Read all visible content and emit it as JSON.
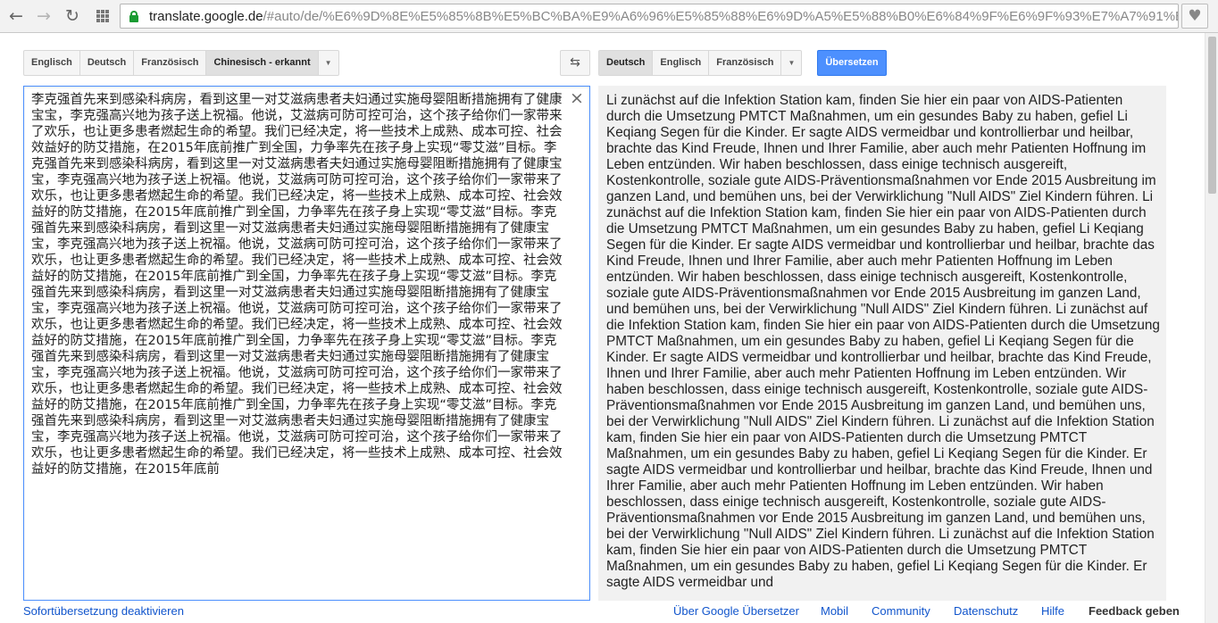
{
  "browser": {
    "back_icon": "arrow-left-icon",
    "forward_icon": "arrow-right-icon",
    "reload_icon": "reload-icon",
    "url_host": "translate.google.de",
    "url_path": "/#auto/de/%E6%9D%8E%E5%85%8B%E5%BC%BA%E9%A6%96%E5%85%88%E6%9D%A5%E5%88%B0%E6%84%9F%E6%9F%93%E7%A7%91%E7%97%85%E6%88%BF%EF%BC%8C",
    "secure_color": "#1a9b32"
  },
  "source_langs": [
    {
      "label": "Englisch"
    },
    {
      "label": "Deutsch"
    },
    {
      "label": "Französisch"
    },
    {
      "label": "Chinesisch - erkannt",
      "active": true
    }
  ],
  "target_langs": [
    {
      "label": "Deutsch",
      "active": true
    },
    {
      "label": "Englisch"
    },
    {
      "label": "Französisch"
    }
  ],
  "dropdown_glyph": "▼",
  "swap_glyph": "⇆",
  "translate_label": "Übersetzen",
  "accent_color": "#4d90fe",
  "source_text": "李克强首先来到感染科病房，看到这里一对艾滋病患者夫妇通过实施母婴阻断措施拥有了健康宝宝，李克强高兴地为孩子送上祝福。他说，艾滋病可防可控可治，这个孩子给你们一家带来了欢乐，也让更多患者燃起生命的希望。我们已经决定，将一些技术上成熟、成本可控、社会效益好的防艾措施，在2015年底前推广到全国，力争率先在孩子身上实现“零艾滋”目标。李克强首先来到感染科病房，看到这里一对艾滋病患者夫妇通过实施母婴阻断措施拥有了健康宝宝，李克强高兴地为孩子送上祝福。他说，艾滋病可防可控可治，这个孩子给你们一家带来了欢乐，也让更多患者燃起生命的希望。我们已经决定，将一些技术上成熟、成本可控、社会效益好的防艾措施，在2015年底前推广到全国，力争率先在孩子身上实现“零艾滋”目标。李克强首先来到感染科病房，看到这里一对艾滋病患者夫妇通过实施母婴阻断措施拥有了健康宝宝，李克强高兴地为孩子送上祝福。他说，艾滋病可防可控可治，这个孩子给你们一家带来了欢乐，也让更多患者燃起生命的希望。我们已经决定，将一些技术上成熟、成本可控、社会效益好的防艾措施，在2015年底前推广到全国，力争率先在孩子身上实现“零艾滋”目标。李克强首先来到感染科病房，看到这里一对艾滋病患者夫妇通过实施母婴阻断措施拥有了健康宝宝，李克强高兴地为孩子送上祝福。他说，艾滋病可防可控可治，这个孩子给你们一家带来了欢乐，也让更多患者燃起生命的希望。我们已经决定，将一些技术上成熟、成本可控、社会效益好的防艾措施，在2015年底前推广到全国，力争率先在孩子身上实现“零艾滋”目标。李克强首先来到感染科病房，看到这里一对艾滋病患者夫妇通过实施母婴阻断措施拥有了健康宝宝，李克强高兴地为孩子送上祝福。他说，艾滋病可防可控可治，这个孩子给你们一家带来了欢乐，也让更多患者燃起生命的希望。我们已经决定，将一些技术上成熟、成本可控、社会效益好的防艾措施，在2015年底前推广到全国，力争率先在孩子身上实现“零艾滋”目标。李克强首先来到感染科病房，看到这里一对艾滋病患者夫妇通过实施母婴阻断措施拥有了健康宝宝，李克强高兴地为孩子送上祝福。他说，艾滋病可防可控可治，这个孩子给你们一家带来了欢乐，也让更多患者燃起生命的希望。我们已经决定，将一些技术上成熟、成本可控、社会效益好的防艾措施，在2015年底前",
  "clear_glyph": "×",
  "result_text": "Li zunächst auf die Infektion Station kam, finden Sie hier ein paar von AIDS-Patienten durch die Umsetzung PMTCT Maßnahmen, um ein gesundes Baby zu haben, gefiel Li Keqiang Segen für die Kinder. Er sagte AIDS vermeidbar und kontrollierbar und heilbar, brachte das Kind Freude, Ihnen und Ihrer Familie, aber auch mehr Patienten Hoffnung im Leben entzünden. Wir haben beschlossen, dass einige technisch ausgereift, Kostenkontrolle, soziale gute AIDS-Präventionsmaßnahmen vor Ende 2015 Ausbreitung im ganzen Land, und bemühen uns, bei der Verwirklichung \"Null AIDS\" Ziel Kindern führen. Li zunächst auf die Infektion Station kam, finden Sie hier ein paar von AIDS-Patienten durch die Umsetzung PMTCT Maßnahmen, um ein gesundes Baby zu haben, gefiel Li Keqiang Segen für die Kinder. Er sagte AIDS vermeidbar und kontrollierbar und heilbar, brachte das Kind Freude, Ihnen und Ihrer Familie, aber auch mehr Patienten Hoffnung im Leben entzünden. Wir haben beschlossen, dass einige technisch ausgereift, Kostenkontrolle, soziale gute AIDS-Präventionsmaßnahmen vor Ende 2015 Ausbreitung im ganzen Land, und bemühen uns, bei der Verwirklichung \"Null AIDS\" Ziel Kindern führen. Li zunächst auf die Infektion Station kam, finden Sie hier ein paar von AIDS-Patienten durch die Umsetzung PMTCT Maßnahmen, um ein gesundes Baby zu haben, gefiel Li Keqiang Segen für die Kinder. Er sagte AIDS vermeidbar und kontrollierbar und heilbar, brachte das Kind Freude, Ihnen und Ihrer Familie, aber auch mehr Patienten Hoffnung im Leben entzünden. Wir haben beschlossen, dass einige technisch ausgereift, Kostenkontrolle, soziale gute AIDS-Präventionsmaßnahmen vor Ende 2015 Ausbreitung im ganzen Land, und bemühen uns, bei der Verwirklichung \"Null AIDS\" Ziel Kindern führen. Li zunächst auf die Infektion Station kam, finden Sie hier ein paar von AIDS-Patienten durch die Umsetzung PMTCT Maßnahmen, um ein gesundes Baby zu haben, gefiel Li Keqiang Segen für die Kinder. Er sagte AIDS vermeidbar und kontrollierbar und heilbar, brachte das Kind Freude, Ihnen und Ihrer Familie, aber auch mehr Patienten Hoffnung im Leben entzünden. Wir haben beschlossen, dass einige technisch ausgereift, Kostenkontrolle, soziale gute AIDS-Präventionsmaßnahmen vor Ende 2015 Ausbreitung im ganzen Land, und bemühen uns, bei der Verwirklichung \"Null AIDS\" Ziel Kindern führen. Li zunächst auf die Infektion Station kam, finden Sie hier ein paar von AIDS-Patienten durch die Umsetzung PMTCT Maßnahmen, um ein gesundes Baby zu haben, gefiel Li Keqiang Segen für die Kinder. Er sagte AIDS vermeidbar und",
  "footer": {
    "instant_off": "Sofortübersetzung deaktivieren",
    "about": "Über Google Übersetzer",
    "mobile": "Mobil",
    "community": "Community",
    "privacy": "Datenschutz",
    "help": "Hilfe",
    "feedback": "Feedback geben"
  }
}
